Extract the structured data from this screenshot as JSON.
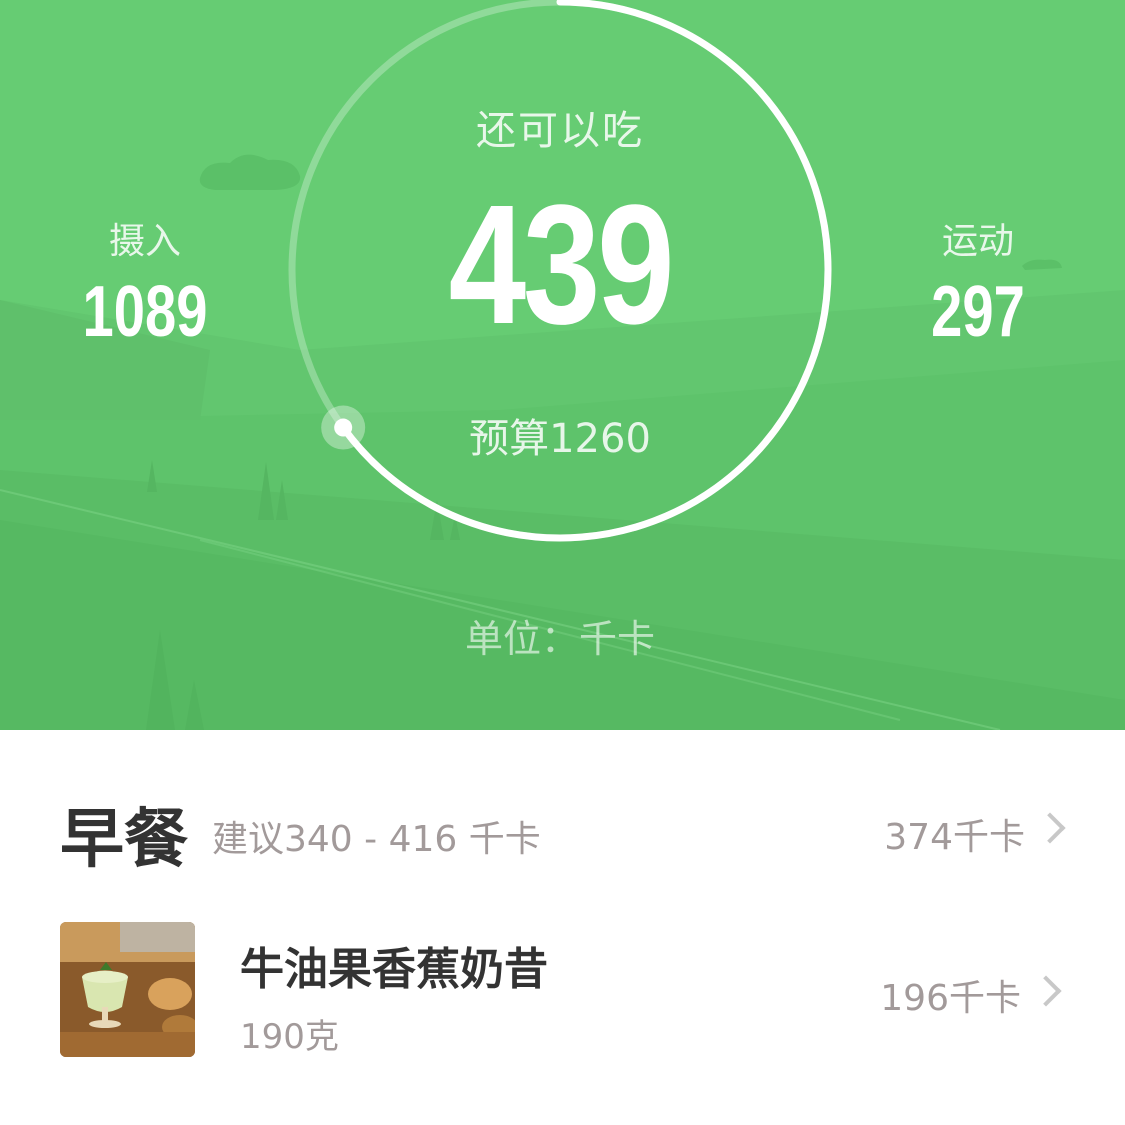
{
  "summary": {
    "remaining_label": "还可以吃",
    "remaining_value": "439",
    "budget": "预算1260",
    "intake_label": "摄入",
    "intake_value": "1089",
    "exercise_label": "运动",
    "exercise_value": "297",
    "unit_note": "单位：千卡",
    "progress": 0.65
  },
  "meal": {
    "title": "早餐",
    "suggestion": "建议340 - 416 千卡",
    "total": "374千卡",
    "items": [
      {
        "name": "牛油果香蕉奶昔",
        "weight": "190克",
        "kcal": "196千卡",
        "thumb_icon": "milkshake-photo"
      }
    ]
  },
  "colors": {
    "hero_green": "#66cc73",
    "text_dark": "#333333",
    "text_gray": "#a29a9a"
  }
}
